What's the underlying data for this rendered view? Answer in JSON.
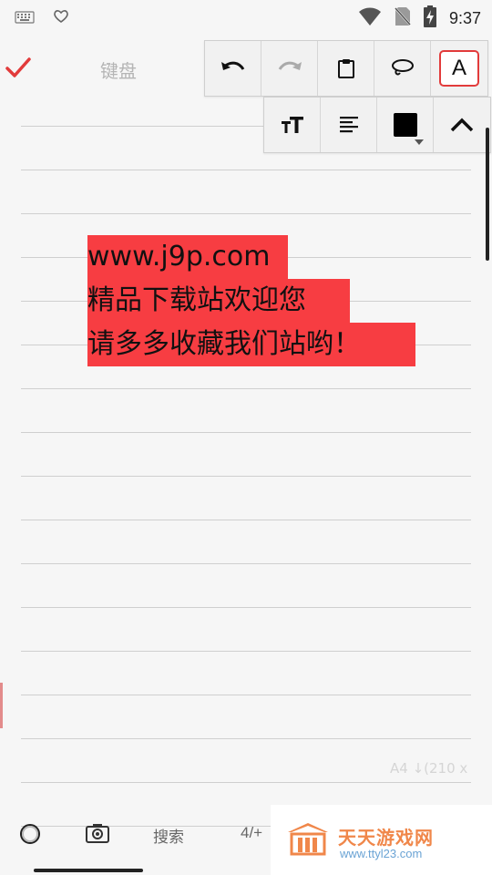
{
  "status_bar": {
    "time": "9:37",
    "left_icons": [
      "keyboard-icon",
      "heart-icon"
    ],
    "right_icons": [
      "wifi-icon",
      "no-sim-icon",
      "battery-charging-icon"
    ]
  },
  "header": {
    "title": "键盘",
    "confirm_icon": "checkmark-icon",
    "accent_color": "#e23b3b"
  },
  "toolbar": {
    "row1": [
      "undo-icon",
      "redo-icon",
      "clipboard-icon",
      "lasso-icon",
      "text-mode-icon"
    ],
    "row2": [
      "text-size-icon",
      "align-left-icon",
      "color-picker-icon",
      "collapse-icon"
    ],
    "text_mode_label": "A",
    "selected_tool": "text-mode",
    "current_color": "#000000"
  },
  "note": {
    "lines": [
      "www.j9p.com",
      "精品下载站欢迎您",
      "请多多收藏我们站哟！"
    ],
    "highlight_color": "#f73d42"
  },
  "page_size_label": "A4 ↓(210 x",
  "bottom_bar": {
    "search_label": "搜索",
    "page_count": "4/+",
    "icons": [
      "circle-tool-icon",
      "camera-icon"
    ]
  },
  "watermark": {
    "title": "天天游戏网",
    "url": "www.ttyl23.com"
  }
}
